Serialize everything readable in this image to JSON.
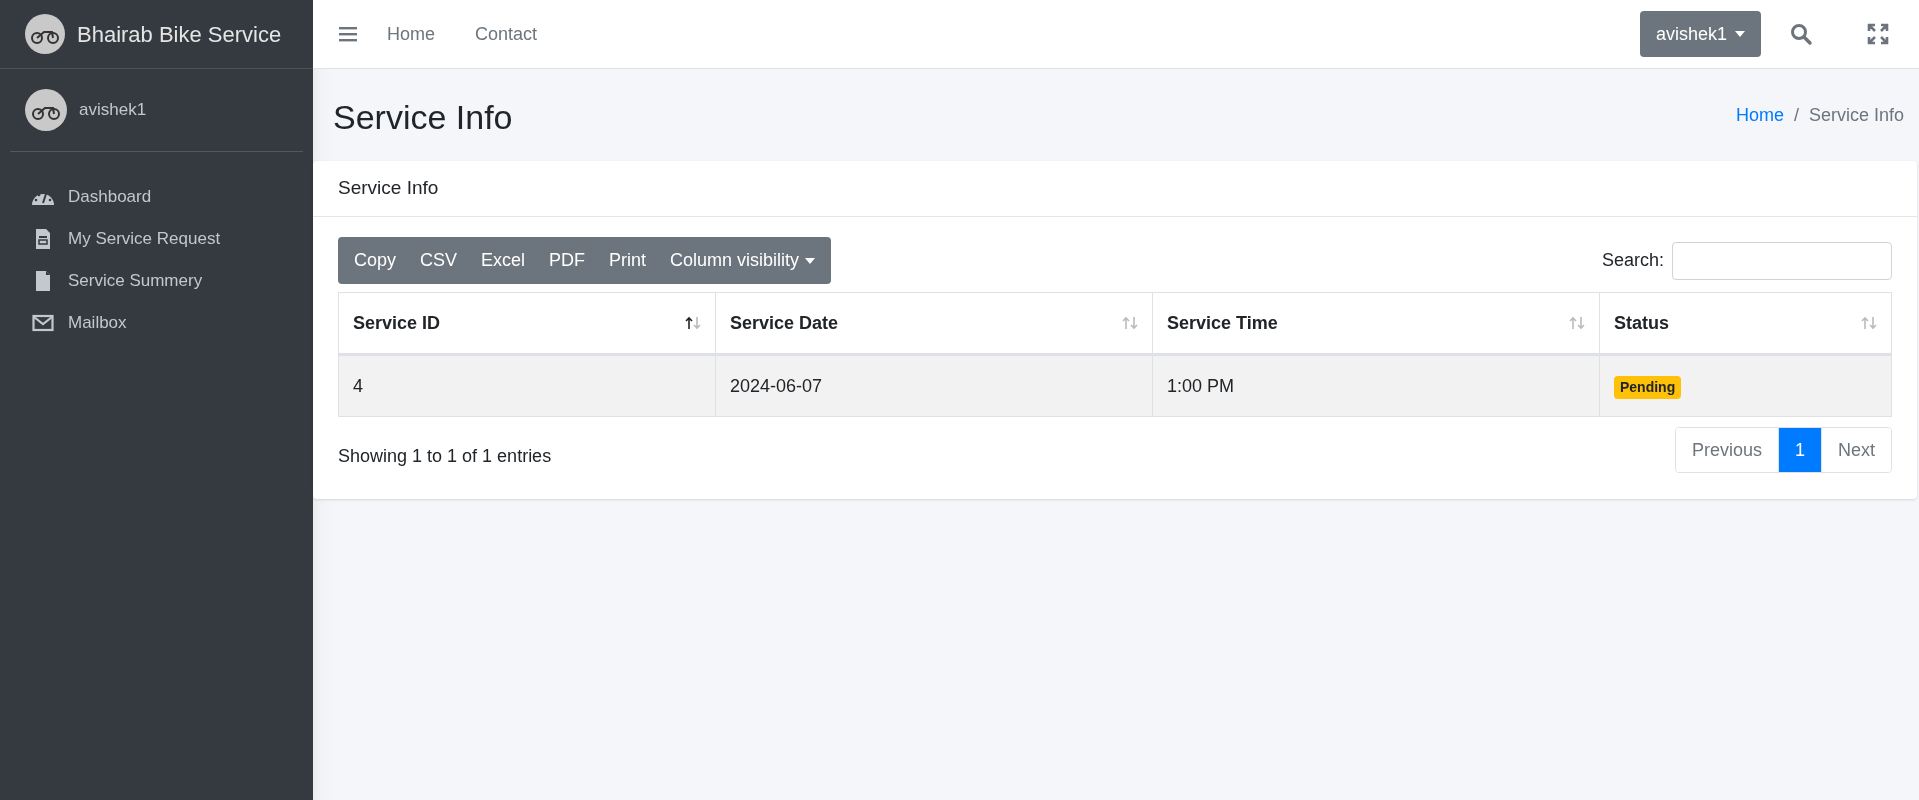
{
  "sidebar": {
    "brand": "Bhairab Bike Service",
    "user": "avishek1",
    "items": [
      {
        "label": "Dashboard"
      },
      {
        "label": "My Service Request"
      },
      {
        "label": "Service Summery"
      },
      {
        "label": "Mailbox"
      }
    ]
  },
  "topbar": {
    "links": [
      "Home",
      "Contact"
    ],
    "user_button": "avishek1"
  },
  "page_header": {
    "title": "Service Info",
    "breadcrumb_separator": "/",
    "breadcrumb": [
      {
        "label": "Home",
        "link": true
      },
      {
        "label": "Service Info",
        "link": false
      }
    ]
  },
  "card": {
    "title": "Service Info",
    "export_buttons": [
      {
        "label": "Copy",
        "dropdown": false
      },
      {
        "label": "CSV",
        "dropdown": false
      },
      {
        "label": "Excel",
        "dropdown": false
      },
      {
        "label": "PDF",
        "dropdown": false
      },
      {
        "label": "Print",
        "dropdown": false
      },
      {
        "label": "Column visibility",
        "dropdown": true
      }
    ],
    "search_label": "Search:",
    "table": {
      "columns": [
        {
          "label": "Service ID",
          "sorted": true
        },
        {
          "label": "Service Date",
          "sorted": false
        },
        {
          "label": "Service Time",
          "sorted": false
        },
        {
          "label": "Status",
          "sorted": false
        }
      ],
      "rows": [
        {
          "cells": [
            "4",
            "2024-06-07",
            "1:00 PM"
          ],
          "status": {
            "label": "Pending",
            "color": "#ffc107"
          }
        }
      ]
    },
    "info": "Showing 1 to 1 of 1 entries",
    "pagination": [
      {
        "label": "Previous",
        "selected": false
      },
      {
        "label": "1",
        "selected": true
      },
      {
        "label": "Next",
        "selected": false
      }
    ]
  }
}
